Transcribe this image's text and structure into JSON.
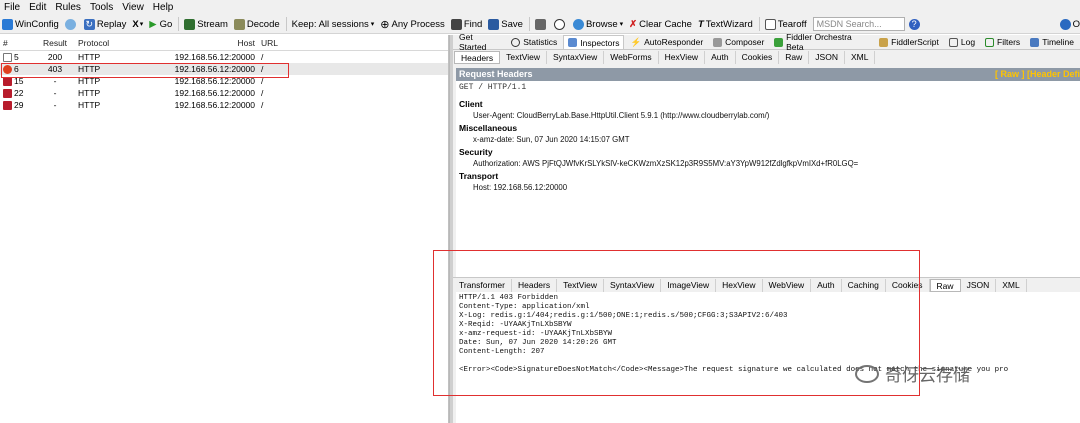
{
  "menu": [
    "File",
    "Edit",
    "Rules",
    "Tools",
    "View",
    "Help"
  ],
  "toolbar": {
    "winconfig": "WinConfig",
    "replay": "Replay",
    "x_label": "X",
    "go": "Go",
    "stream": "Stream",
    "decode": "Decode",
    "keep": "Keep: All sessions",
    "any_process": "Any Process",
    "find": "Find",
    "save": "Save",
    "browse": "Browse",
    "clear_cache": "Clear Cache",
    "textwizard": "TextWizard",
    "tearoff": "Tearoff",
    "msdn_placeholder": "MSDN Search...",
    "online": "O"
  },
  "sessions": {
    "columns": [
      "#",
      "Result",
      "Protocol",
      "Host",
      "URL"
    ],
    "rows": [
      {
        "num": "5",
        "result": "200",
        "protocol": "HTTP",
        "host": "192.168.56.12:20000",
        "url": "/"
      },
      {
        "num": "6",
        "result": "403",
        "protocol": "HTTP",
        "host": "192.168.56.12:20000",
        "url": "/"
      },
      {
        "num": "15",
        "result": "-",
        "protocol": "HTTP",
        "host": "192.168.56.12:20000",
        "url": "/"
      },
      {
        "num": "22",
        "result": "-",
        "protocol": "HTTP",
        "host": "192.168.56.12:20000",
        "url": "/"
      },
      {
        "num": "29",
        "result": "-",
        "protocol": "HTTP",
        "host": "192.168.56.12:20000",
        "url": "/"
      }
    ]
  },
  "top_tabs": [
    "Get Started",
    "Statistics",
    "Inspectors",
    "AutoResponder",
    "Composer",
    "Fiddler Orchestra Beta",
    "FiddlerScript",
    "Log",
    "Filters",
    "Timeline"
  ],
  "request_tabs": [
    "Headers",
    "TextView",
    "SyntaxView",
    "WebForms",
    "HexView",
    "Auth",
    "Cookies",
    "Raw",
    "JSON",
    "XML"
  ],
  "request_headers": {
    "title": "Request Headers",
    "right_links": "[ Raw ]   [Header Defi",
    "request_line": "GET / HTTP/1.1",
    "groups": [
      {
        "name": "Client",
        "headers": [
          "User-Agent: CloudBerryLab.Base.HttpUtil.Client 5.9.1 (http://www.cloudberrylab.com/)"
        ]
      },
      {
        "name": "Miscellaneous",
        "headers": [
          "x-amz-date: Sun, 07 Jun 2020 14:15:07 GMT"
        ]
      },
      {
        "name": "Security",
        "headers": [
          "Authorization: AWS PjFtQJWfvKrSLYkSlV-keCKWzmXzSK12p3R9S5MV:aY3YpW912fZdlgfkpVmIXd+fR0LGQ="
        ]
      },
      {
        "name": "Transport",
        "headers": [
          "Host: 192.168.56.12:20000"
        ]
      }
    ]
  },
  "response_tabs": [
    "Transformer",
    "Headers",
    "TextView",
    "SyntaxView",
    "ImageView",
    "HexView",
    "WebView",
    "Auth",
    "Caching",
    "Cookies",
    "Raw",
    "JSON",
    "XML"
  ],
  "response_raw": "HTTP/1.1 403 Forbidden\nContent-Type: application/xml\nX-Log: redis.g:1/404;redis.g:1/500;ONE:1;redis.s/500;CFGG:3;S3APIV2:6/403\nX-Reqid: -UYAAKjTnLXbSBYW\nx-amz-request-id: -UYAAKjTnLXbSBYW\nDate: Sun, 07 Jun 2020 14:20:26 GMT\nContent-Length: 207\n\n<Error><Code>SignatureDoesNotMatch</Code><Message>The request signature we calculated does not match the signature you pro",
  "watermark": "奇伢云存储",
  "colors": {
    "highlight_box": "#e03030",
    "header_bar": "#8e99a6",
    "header_links": "#ffc400"
  }
}
